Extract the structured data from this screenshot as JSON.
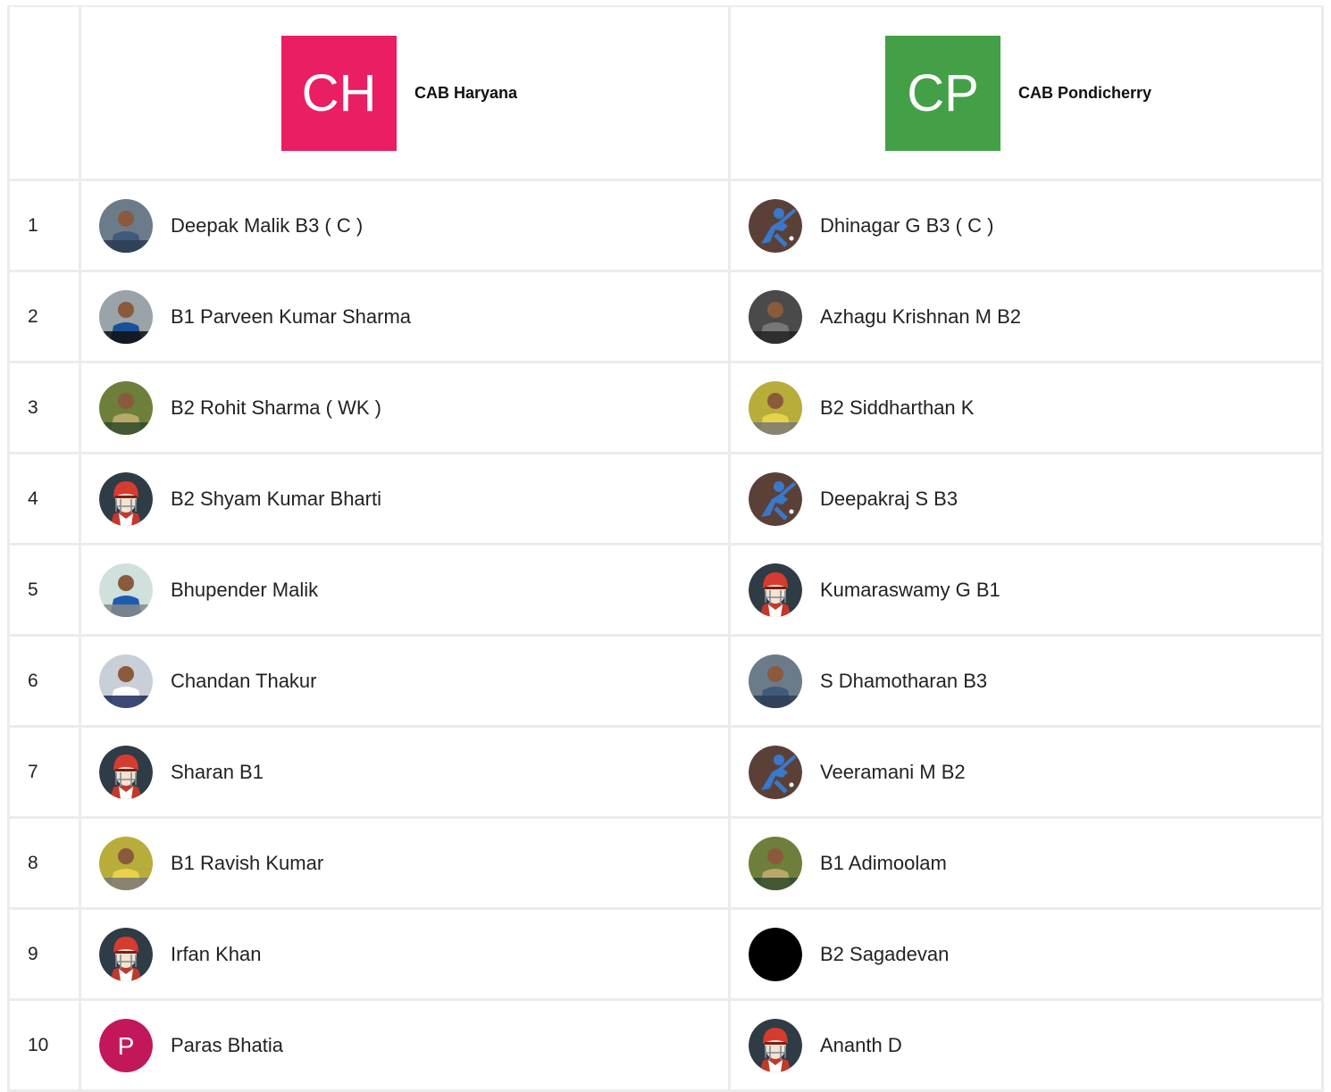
{
  "teams": {
    "home": {
      "initials": "CH",
      "name": "CAB Haryana",
      "color": "#e91e63"
    },
    "away": {
      "initials": "CP",
      "name": "CAB Pondicherry",
      "color": "#43a047"
    }
  },
  "rows": [
    {
      "num": "1",
      "home": {
        "name": "Deepak Malik B3 ( C )",
        "avatar": "photo-avatar"
      },
      "away": {
        "name": "Dhinagar G B3 ( C )",
        "avatar": "batsman-icon"
      }
    },
    {
      "num": "2",
      "home": {
        "name": "B1 Parveen Kumar Sharma",
        "avatar": "photo-avatar"
      },
      "away": {
        "name": "Azhagu Krishnan M B2",
        "avatar": "photo-avatar"
      }
    },
    {
      "num": "3",
      "home": {
        "name": "B2 Rohit Sharma ( WK )",
        "avatar": "photo-avatar"
      },
      "away": {
        "name": "B2 Siddharthan K",
        "avatar": "photo-avatar"
      }
    },
    {
      "num": "4",
      "home": {
        "name": "B2 Shyam Kumar Bharti",
        "avatar": "helmet-icon"
      },
      "away": {
        "name": "Deepakraj S B3",
        "avatar": "batsman-icon"
      }
    },
    {
      "num": "5",
      "home": {
        "name": "Bhupender Malik",
        "avatar": "photo-avatar"
      },
      "away": {
        "name": "Kumaraswamy G B1",
        "avatar": "helmet-icon"
      }
    },
    {
      "num": "6",
      "home": {
        "name": "Chandan Thakur",
        "avatar": "photo-avatar"
      },
      "away": {
        "name": "S Dhamotharan B3",
        "avatar": "photo-avatar"
      }
    },
    {
      "num": "7",
      "home": {
        "name": "Sharan B1",
        "avatar": "helmet-icon"
      },
      "away": {
        "name": "Veeramani M B2",
        "avatar": "batsman-icon"
      }
    },
    {
      "num": "8",
      "home": {
        "name": "B1 Ravish Kumar",
        "avatar": "photo-avatar"
      },
      "away": {
        "name": "B1 Adimoolam",
        "avatar": "photo-avatar"
      }
    },
    {
      "num": "9",
      "home": {
        "name": "Irfan Khan",
        "avatar": "helmet-icon"
      },
      "away": {
        "name": "B2 Sagadevan",
        "avatar": "blank-avatar"
      }
    },
    {
      "num": "10",
      "home": {
        "name": "Paras Bhatia",
        "avatar": "initial-avatar",
        "initial": "P"
      },
      "away": {
        "name": "Ananth D",
        "avatar": "helmet-icon"
      }
    }
  ]
}
